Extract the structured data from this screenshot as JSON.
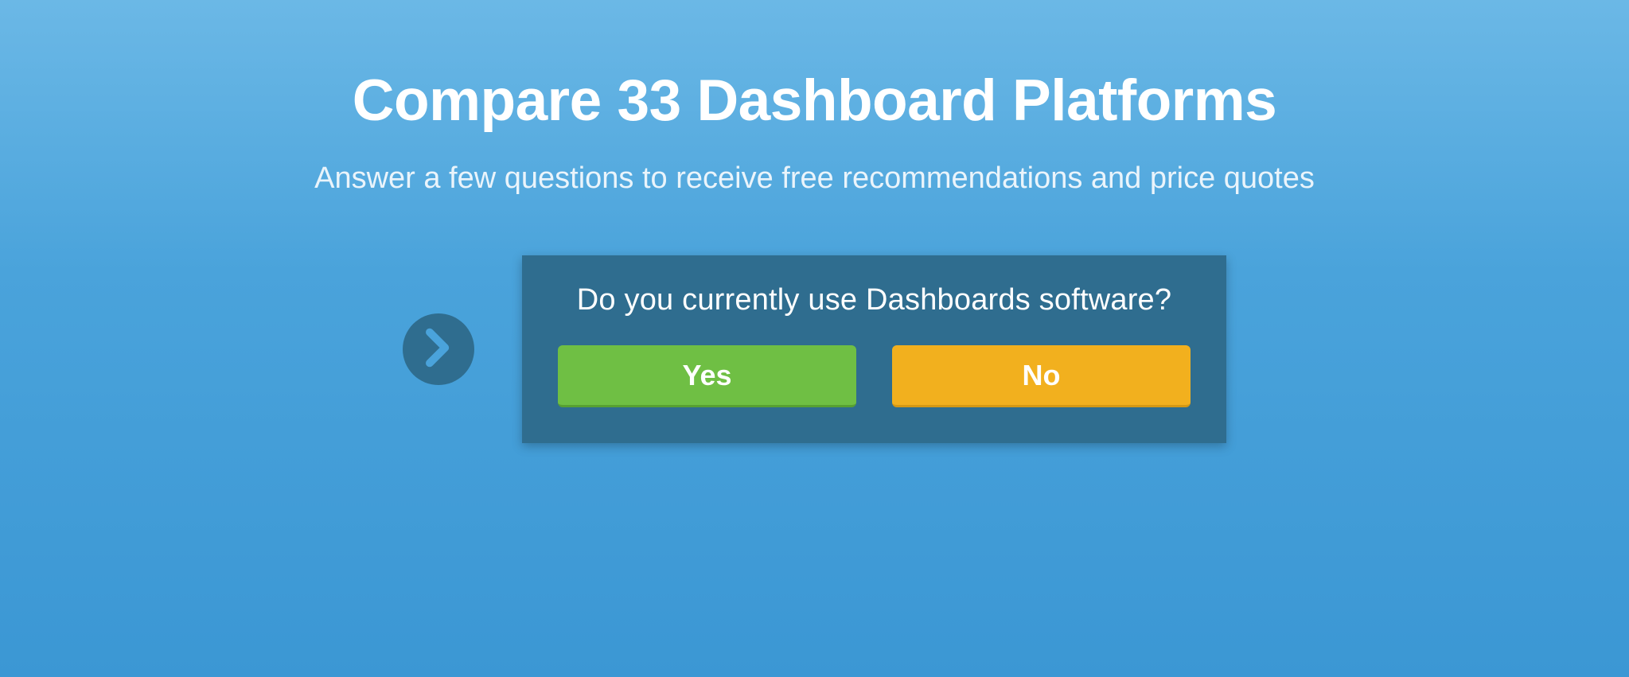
{
  "header": {
    "title": "Compare 33 Dashboard Platforms",
    "subtitle": "Answer a few questions to receive free recommendations and price quotes"
  },
  "question": {
    "prompt": "Do you currently use Dashboards software?",
    "yes_label": "Yes",
    "no_label": "No"
  }
}
